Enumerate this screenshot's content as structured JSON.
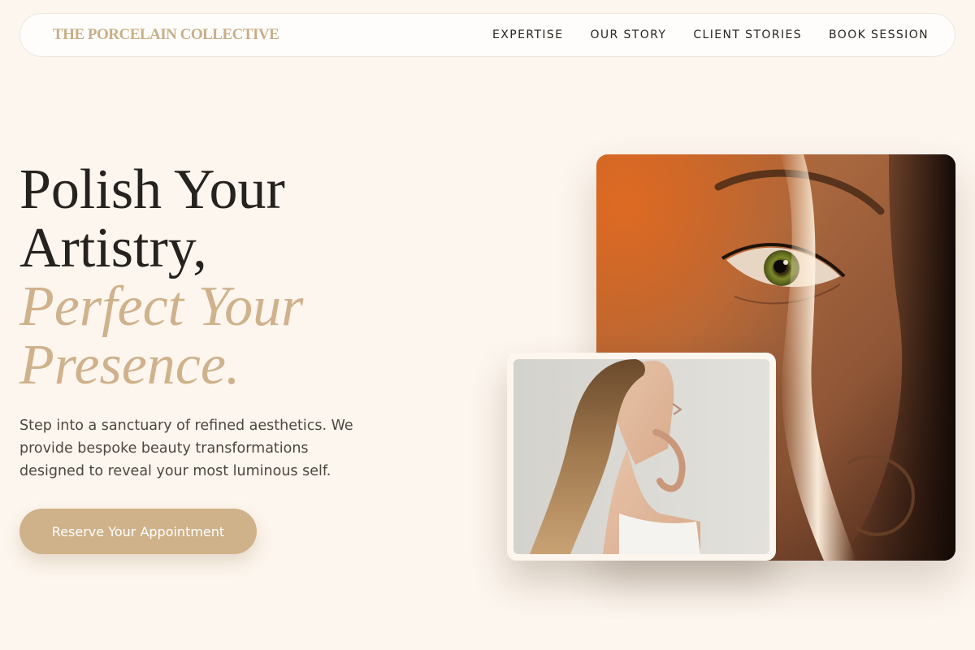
{
  "brand": {
    "name": "THE PORCELAIN COLLECTIVE"
  },
  "nav": {
    "items": [
      {
        "label": "EXPERTISE"
      },
      {
        "label": "OUR STORY"
      },
      {
        "label": "CLIENT STORIES"
      },
      {
        "label": "BOOK SESSION"
      }
    ]
  },
  "hero": {
    "title_lines": [
      "Polish Your",
      "Artistry,"
    ],
    "accent_lines": [
      "Perfect Your",
      "Presence."
    ],
    "description": "Step into a sanctuary of refined aesthetics. We provide bespoke beauty transformations designed to reveal your most luminous self.",
    "cta_label": "Reserve Your Appointment"
  },
  "images": {
    "main": {
      "alt": "beauty",
      "icon": "closeup-eye-photo"
    },
    "inset": {
      "alt": "NPR beauty",
      "icon": "profile-woman-photo"
    }
  },
  "colors": {
    "background": "#fdf6ee",
    "accent": "#cfb18a",
    "brand": "#c9ae88",
    "text_dark": "#25221f"
  }
}
